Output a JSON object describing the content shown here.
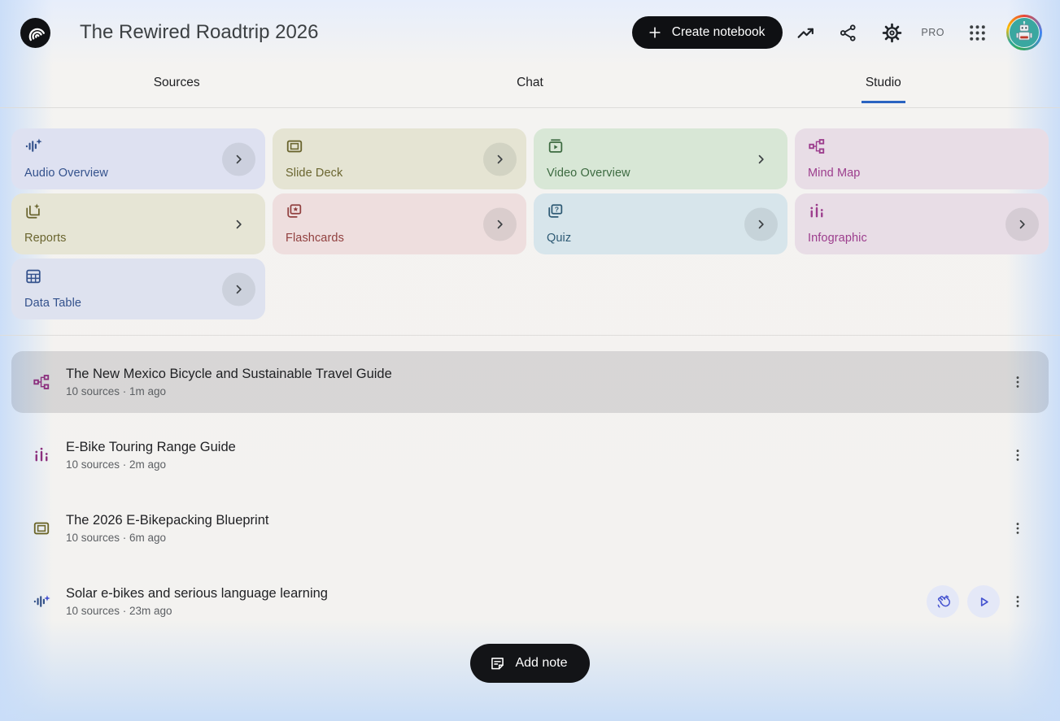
{
  "header": {
    "title": "The Rewired Roadtrip 2026",
    "create_notebook_label": "Create notebook",
    "pro_badge": "PRO"
  },
  "tabs": [
    {
      "label": "Sources",
      "active": false
    },
    {
      "label": "Chat",
      "active": false
    },
    {
      "label": "Studio",
      "active": true
    }
  ],
  "icons": {
    "logo": "notebooklm-wave-mark",
    "trending": "trending-up-arrow",
    "share": "share-nodes",
    "settings": "gear",
    "apps": "nine-dot-grid",
    "avatar": "robot-profile-photo-with-google-colors-ring",
    "chevron": "chevron-right",
    "more": "three-dot-vertical-menu",
    "interactive": "waving-hand",
    "play": "play-triangle",
    "add_note": "note-sheet",
    "create": "plus"
  },
  "colors": {
    "tab_underline": "#2b63c1",
    "selected_row_bg": "rgba(33,33,36,0.13)",
    "action_icon": "#4553d0",
    "action_circle_bg": "#e4e8f7",
    "pill_button_bg": "#101114",
    "page_edge_tint": "#c9ddf6"
  },
  "studio": {
    "tools": [
      {
        "label": "Audio Overview",
        "icon": "audio-overview-icon",
        "bg": "#dee1f1",
        "fg": "#33518c",
        "chevron": "circle"
      },
      {
        "label": "Slide Deck",
        "icon": "slide-deck-icon",
        "bg": "#e5e4d3",
        "fg": "#6a652f",
        "chevron": "circle"
      },
      {
        "label": "Video Overview",
        "icon": "video-overview-icon",
        "bg": "#d8e7d6",
        "fg": "#3c6a40",
        "chevron": "plain"
      },
      {
        "label": "Mind Map",
        "icon": "mind-map-icon",
        "bg": "#e8dde6",
        "fg": "#9c3d8d",
        "chevron": "none"
      },
      {
        "label": "Reports",
        "icon": "reports-icon",
        "bg": "#e6e5d5",
        "fg": "#6a652f",
        "chevron": "plain"
      },
      {
        "label": "Flashcards",
        "icon": "flashcards-icon",
        "bg": "#eedede",
        "fg": "#91403f",
        "chevron": "circle"
      },
      {
        "label": "Quiz",
        "icon": "quiz-icon",
        "bg": "#d7e5eb",
        "fg": "#2e5a74",
        "chevron": "circle"
      },
      {
        "label": "Infographic",
        "icon": "infographic-icon",
        "bg": "#e8dde6",
        "fg": "#9c3d8d",
        "chevron": "circle"
      },
      {
        "label": "Data Table",
        "icon": "data-table-icon",
        "bg": "#dee2ef",
        "fg": "#33518c",
        "chevron": "circle"
      }
    ],
    "artifacts": [
      {
        "icon": "mind-map-icon",
        "icon_color": "#8b2f7e",
        "title": "The New Mexico Bicycle and Sustainable Travel Guide",
        "meta": "10 sources · 1m ago",
        "selected": true
      },
      {
        "icon": "infographic-icon",
        "icon_color": "#8b2f7e",
        "title": "E-Bike Touring Range Guide",
        "meta": "10 sources · 2m ago",
        "selected": false
      },
      {
        "icon": "slide-deck-icon",
        "icon_color": "#6b6528",
        "title": "The 2026 E-Bikepacking Blueprint",
        "meta": "10 sources · 6m ago",
        "selected": false
      },
      {
        "icon": "audio-overview-icon",
        "icon_color": "#2f4d85",
        "title": "Solar e-bikes and serious language learning",
        "meta": "10 sources · 23m ago",
        "selected": false
      }
    ],
    "add_note_label": "Add note"
  }
}
